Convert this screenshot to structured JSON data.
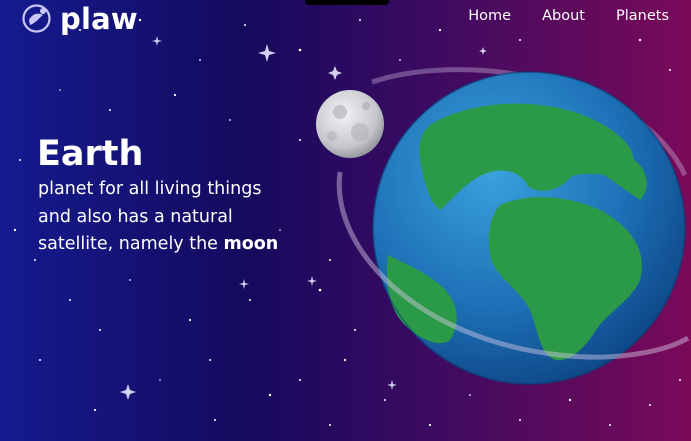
{
  "brand": {
    "name": "plaw",
    "logo_icon": "planet-logo-icon"
  },
  "nav": [
    {
      "label": "Home"
    },
    {
      "label": "About"
    },
    {
      "label": "Planets"
    }
  ],
  "hero": {
    "title": "Earth",
    "description_line": "planet for all living things and also has a natural satellite, namely the",
    "highlight": "moon"
  },
  "illustrations": {
    "earth": "earth-planet",
    "moon": "moon"
  },
  "colors": {
    "background_left": "#141b8f",
    "background_mid": "#140a5e",
    "background_right": "#7a0a59",
    "text": "#ffffff",
    "ocean": "#1f78c4",
    "land": "#2fa84f"
  }
}
